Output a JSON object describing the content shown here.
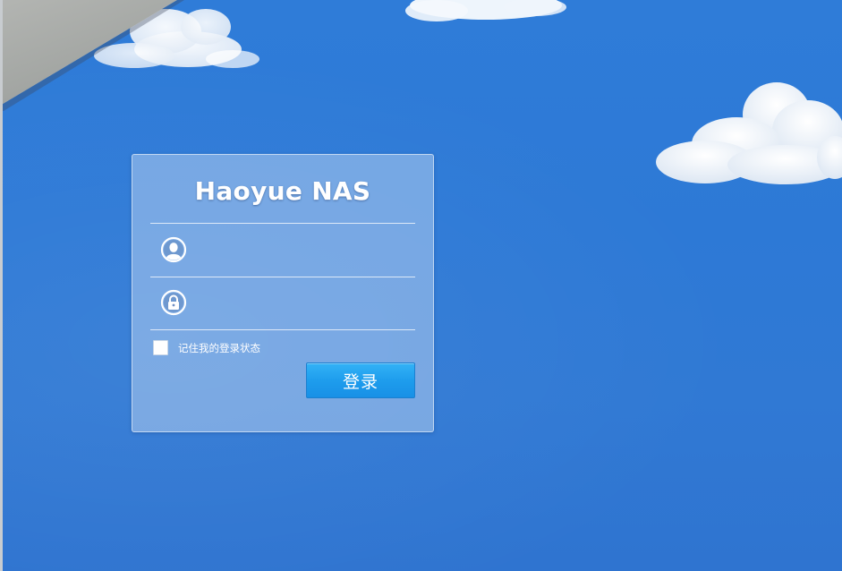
{
  "app": {
    "title": "Haoyue NAS"
  },
  "login": {
    "username": {
      "icon": "user-icon",
      "value": "",
      "placeholder": ""
    },
    "password": {
      "icon": "lock-icon",
      "value": "",
      "placeholder": ""
    },
    "remember_label": "记住我的登录状态",
    "remember_checked": false,
    "submit_label": "登录"
  },
  "colors": {
    "sky": "#2f7cd8",
    "button": "#1e9ded",
    "panel_text": "#ffffff"
  }
}
